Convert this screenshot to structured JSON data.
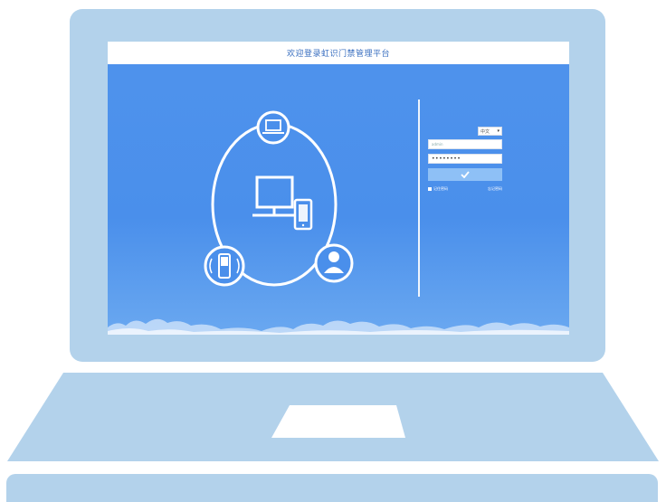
{
  "screen": {
    "title": "欢迎登录虹识门禁管理平台"
  },
  "login": {
    "language_selected": "中文",
    "username_value": "admin",
    "password_value": "••••••••",
    "submit_icon": "check-icon",
    "remember_label": "记住密码",
    "forgot_label": "忘记密码"
  },
  "colors": {
    "laptop_frame": "#b3d2eb",
    "screen_background": "#4a8feb",
    "submit_button": "#8ec0f6",
    "header_background": "#ffffff"
  },
  "icons": [
    "laptop-icon",
    "desktop-monitor-icon",
    "smartphone-icon",
    "handheld-scanner-icon",
    "user-icon",
    "check-icon"
  ]
}
